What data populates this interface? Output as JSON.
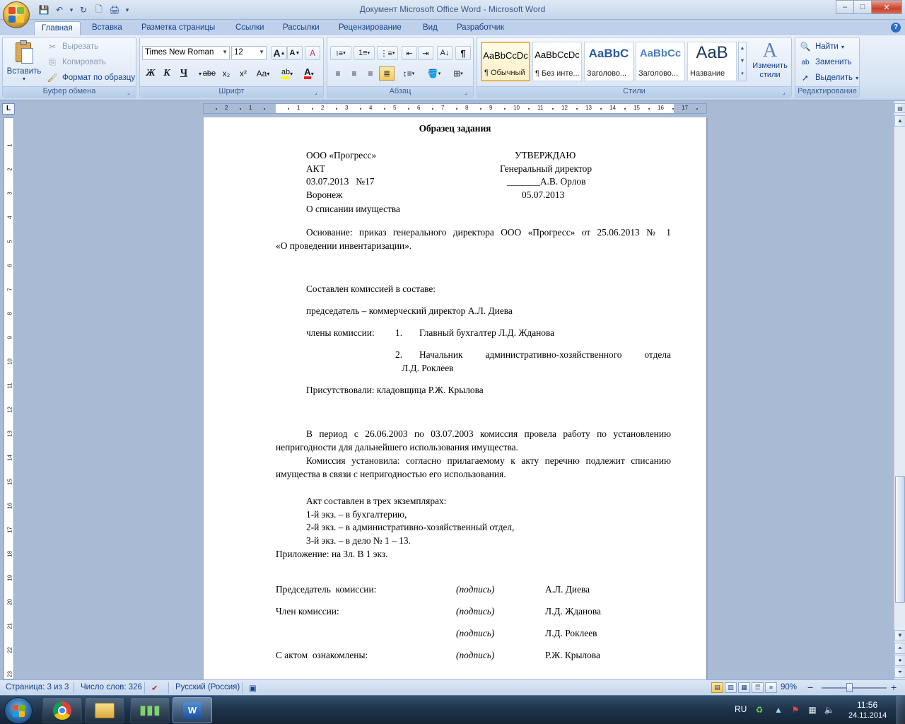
{
  "window": {
    "title": "Документ Microsoft Office Word - Microsoft Word",
    "controls": {
      "minimize": "–",
      "maximize": "□",
      "close": "✕"
    }
  },
  "qat": {
    "save": "💾",
    "undo": "↶",
    "undo_dd": "▾",
    "redo": "↻",
    "new": "🗋",
    "print": "🖨",
    "customize": "▾"
  },
  "tabs": [
    "Главная",
    "Вставка",
    "Разметка страницы",
    "Ссылки",
    "Рассылки",
    "Рецензирование",
    "Вид",
    "Разработчик"
  ],
  "help": "?",
  "clipboard": {
    "paste_label": "Вставить",
    "cut_label": "Вырезать",
    "copy_label": "Копировать",
    "format_painter_label": "Формат по образцу",
    "group_label": "Буфер обмена"
  },
  "font": {
    "family": "Times New Roman",
    "size": "12",
    "group_label": "Шрифт",
    "bold": "Ж",
    "italic": "К",
    "underline": "Ч",
    "strike": "abe",
    "subscript": "x₂",
    "superscript": "x²",
    "case": "Aa",
    "grow": "A",
    "shrink": "A",
    "clear": "A",
    "highlight": "ab",
    "color": "A"
  },
  "paragraph": {
    "group_label": "Абзац"
  },
  "styles": {
    "group_label": "Стили",
    "items": [
      {
        "sample": "AaBbCcDc",
        "name": "¶ Обычный"
      },
      {
        "sample": "AaBbCcDc",
        "name": "¶ Без инте..."
      },
      {
        "sample": "AaBbC",
        "name": "Заголово..."
      },
      {
        "sample": "AaBbCc",
        "name": "Заголово..."
      },
      {
        "sample": "AaB",
        "name": "Название"
      }
    ],
    "change_styles_label": "Изменить стили"
  },
  "editing": {
    "group_label": "Редактирование",
    "find_label": "Найти",
    "replace_label": "Заменить",
    "select_label": "Выделить"
  },
  "ruler": {
    "tab_selector": "L"
  },
  "document": {
    "heading": "Образец задания",
    "org": "ООО «Прогресс»",
    "approve": "УТВЕРЖДАЮ",
    "doc_type": "АКТ",
    "director": "Генеральный директор",
    "date_num": "03.07.2013   №17",
    "sign_name": "_______А.В. Орлов",
    "city": "Воронеж",
    "approve_date": "05.07.2013",
    "subject": "О списании имущества",
    "basis_1": "Основание: приказ генерального директора ООО «Прогресс» от 25.06.2013 № 1",
    "basis_2": "«О проведении инвентаризации».",
    "commission": "Составлен комиссией в составе:",
    "chairman": "председатель – коммерческий директор А.Л. Диева",
    "members_label": "члены комиссии:",
    "member1_num": "1.",
    "member1": "Главный бухгалтер Л.Д. Жданова",
    "member2_num": "2.",
    "member2_line1": "Начальник административно-хозяйственного отдела",
    "member2_line2": "Л.Д. Роклеев",
    "present": "Присутствовали: кладовщица Р.Ж. Крылова",
    "para1_l1": "В период с 26.06.2003 по 03.07.2003 комиссия провела работу по установлению",
    "para1_l2": "непригодности для дальнейшего использования имущества.",
    "para2_l1": "Комиссия установила: согласно прилагаемому к акту перечню подлежит списанию",
    "para2_l2": "имущества в связи с непригодностью его использования.",
    "copies": "Акт составлен в трех экземплярах:",
    "copy1": "1-й экз. – в бухгалтерию,",
    "copy2": "2-й экз. – в административно-хозяйственный отдел,",
    "copy3": "3-й экз. – в дело № 1 – 13.",
    "appendix": "Приложение: на 3л. В 1 экз.",
    "signatures": [
      {
        "role": "Председатель  комиссии:",
        "sign": "(подпись)",
        "name": "А.Л. Диева"
      },
      {
        "role": "Член комиссии:",
        "sign": "(подпись)",
        "name": "Л.Д. Жданова"
      },
      {
        "role": "",
        "sign": "(подпись)",
        "name": "Л.Д. Роклеев"
      },
      {
        "role": "С актом  ознакомлены:",
        "sign": "(подпись)",
        "name": "Р.Ж. Крылова"
      }
    ]
  },
  "status": {
    "page": "Страница: 3 из 3",
    "words": "Число слов: 326",
    "language": "Русский (Россия)",
    "zoom": "90%",
    "zoom_minus": "−",
    "zoom_plus": "+"
  },
  "taskbar": {
    "lang": "RU",
    "time": "11:56",
    "date": "24.11.2014"
  }
}
